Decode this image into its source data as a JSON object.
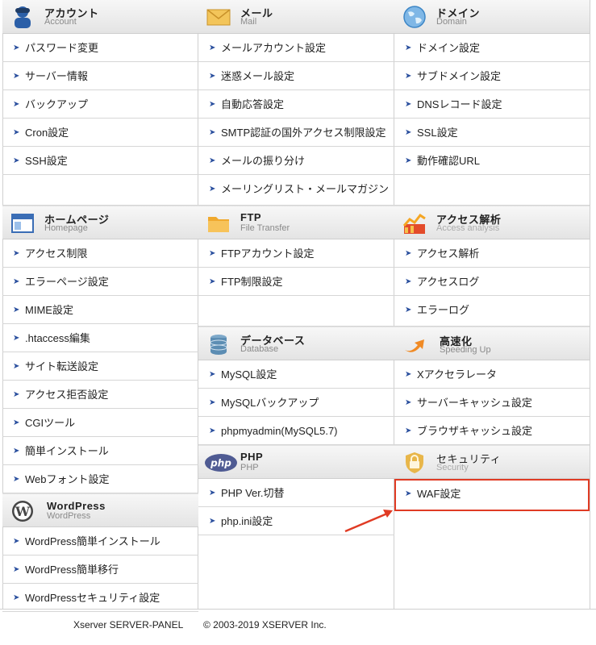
{
  "colors": {
    "accent_link": "#2a4f9e",
    "highlight": "#e03b24",
    "header_bg": "#e8e8e8"
  },
  "sections": {
    "account": {
      "title": "アカウント",
      "subtitle": "Account",
      "icon": "user-icon",
      "items": [
        "パスワード変更",
        "サーバー情報",
        "バックアップ",
        "Cron設定",
        "SSH設定"
      ]
    },
    "mail": {
      "title": "メール",
      "subtitle": "Mail",
      "icon": "envelope-icon",
      "items": [
        "メールアカウント設定",
        "迷惑メール設定",
        "自動応答設定",
        "SMTP認証の国外アクセス制限設定",
        "メールの振り分け",
        "メーリングリスト・メールマガジン"
      ]
    },
    "domain": {
      "title": "ドメイン",
      "subtitle": "Domain",
      "icon": "globe-icon",
      "items": [
        "ドメイン設定",
        "サブドメイン設定",
        "DNSレコード設定",
        "SSL設定",
        "動作確認URL"
      ]
    },
    "homepage": {
      "title": "ホームページ",
      "subtitle": "Homepage",
      "icon": "browser-window-icon",
      "items": [
        "アクセス制限",
        "エラーページ設定",
        "MIME設定",
        ".htaccess編集",
        "サイト転送設定",
        "アクセス拒否設定",
        "CGIツール",
        "簡単インストール",
        "Webフォント設定"
      ]
    },
    "ftp": {
      "title": "FTP",
      "subtitle": "File Transfer",
      "icon": "folder-icon",
      "items": [
        "FTPアカウント設定",
        "FTP制限設定"
      ]
    },
    "access_analysis": {
      "title": "アクセス解析",
      "subtitle": "Access analysis",
      "icon": "chart-icon",
      "items": [
        "アクセス解析",
        "アクセスログ",
        "エラーログ"
      ]
    },
    "database": {
      "title": "データベース",
      "subtitle": "Database",
      "icon": "database-icon",
      "items": [
        "MySQL設定",
        "MySQLバックアップ",
        "phpmyadmin(MySQL5.7)"
      ]
    },
    "speeding": {
      "title": "高速化",
      "subtitle": "Speeding Up",
      "icon": "speed-arrow-icon",
      "items": [
        "Xアクセラレータ",
        "サーバーキャッシュ設定",
        "ブラウザキャッシュ設定"
      ]
    },
    "php": {
      "title": "PHP",
      "subtitle": "PHP",
      "icon": "php-icon",
      "items": [
        "PHP Ver.切替",
        "php.ini設定"
      ]
    },
    "security": {
      "title": "セキュリティ",
      "subtitle": "Security",
      "icon": "lock-shield-icon",
      "items": [
        "WAF設定"
      ]
    },
    "wordpress": {
      "title": "WordPress",
      "subtitle": "WordPress",
      "icon": "wordpress-icon",
      "items": [
        "WordPress簡単インストール",
        "WordPress簡単移行",
        "WordPressセキュリティ設定"
      ]
    }
  },
  "footer": {
    "brand": "Xserver SERVER-PANEL",
    "copyright": "© 2003-2019 XSERVER Inc."
  }
}
